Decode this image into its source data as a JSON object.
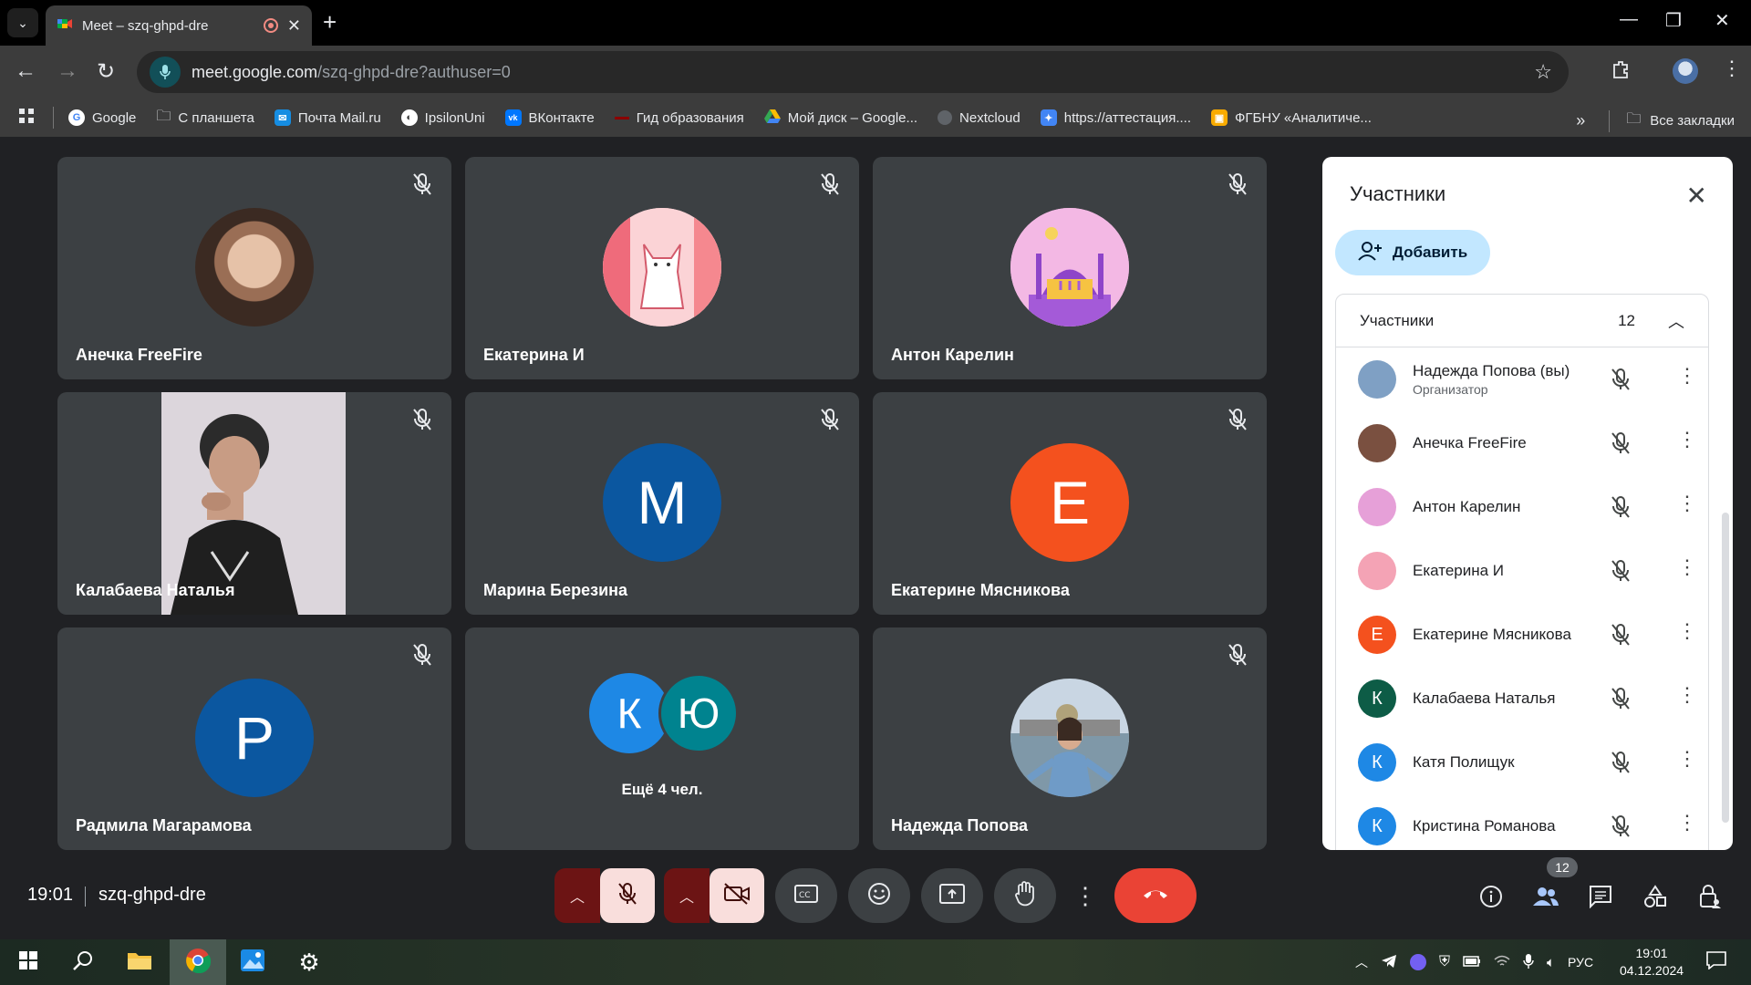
{
  "browser": {
    "tab_title": "Meet – szq-ghpd-dre",
    "url_host": "meet.google.com",
    "url_path": "/szq-ghpd-dre?authuser=0",
    "bookmarks": [
      {
        "label": "Google",
        "color": "#ffffff",
        "glyph": "G"
      },
      {
        "label": "С планшета",
        "color": "",
        "glyph": ""
      },
      {
        "label": "Почта Mail.ru",
        "color": "#168de2",
        "glyph": "@"
      },
      {
        "label": "IpsilonUni",
        "color": "#ffffff",
        "glyph": ""
      },
      {
        "label": "ВКонтакте",
        "color": "#0077ff",
        "glyph": "vk"
      },
      {
        "label": "Гид образования",
        "color": "#8b0000",
        "glyph": ""
      },
      {
        "label": "Мой диск – Google...",
        "color": "#34a853",
        "glyph": ""
      },
      {
        "label": "Nextcloud",
        "color": "#5f6368",
        "glyph": ""
      },
      {
        "label": "https://аттестация....",
        "color": "#4285f4",
        "glyph": ""
      },
      {
        "label": "ФГБНУ «Аналитиче...",
        "color": "#f9ab00",
        "glyph": ""
      }
    ],
    "all_bookmarks": "Все закладки"
  },
  "tiles": [
    {
      "name": "Анечка FreeFire",
      "kind": "photo",
      "bg": "#6b4a3a"
    },
    {
      "name": "Екатерина И",
      "kind": "photo",
      "bg": "#f4a3b5"
    },
    {
      "name": "Антон Карелин",
      "kind": "photo",
      "bg": "#e6a0d8"
    },
    {
      "name": "Калабаева Наталья",
      "kind": "video",
      "bg": ""
    },
    {
      "name": "Марина Березина",
      "kind": "letter",
      "letter": "М",
      "bg": "#0b57a0"
    },
    {
      "name": "Екатерине Мясникова",
      "kind": "letter",
      "letter": "Е",
      "bg": "#f4511e"
    },
    {
      "name": "Радмила Магарамова",
      "kind": "letter",
      "letter": "Р",
      "bg": "#0b57a0"
    },
    {
      "name": "",
      "kind": "more",
      "bg": ""
    },
    {
      "name": "Надежда Попова",
      "kind": "photo",
      "bg": "#9db3c9"
    }
  ],
  "more": {
    "label": "Ещё 4 чел.",
    "a1": {
      "letter": "К",
      "bg": "#1e88e5"
    },
    "a2": {
      "letter": "Ю",
      "bg": "#00838f"
    }
  },
  "panel": {
    "title": "Участники",
    "add_label": "Добавить",
    "group_label": "Участники",
    "group_count": "12",
    "people": [
      {
        "name": "Надежда Попова (вы)",
        "role": "Организатор",
        "letter": "",
        "bg": "#7fa0c4"
      },
      {
        "name": "Анечка FreeFire",
        "role": "",
        "letter": "",
        "bg": "#7a5040"
      },
      {
        "name": "Антон Карелин",
        "role": "",
        "letter": "",
        "bg": "#e6a0d8"
      },
      {
        "name": "Екатерина И",
        "role": "",
        "letter": "",
        "bg": "#f4a3b5"
      },
      {
        "name": "Екатерине Мясникова",
        "role": "",
        "letter": "Е",
        "bg": "#f4511e"
      },
      {
        "name": "Калабаева Наталья",
        "role": "",
        "letter": "К",
        "bg": "#0d5c46"
      },
      {
        "name": "Катя Полищук",
        "role": "",
        "letter": "К",
        "bg": "#1e88e5"
      },
      {
        "name": "Кристина Романова",
        "role": "",
        "letter": "К",
        "bg": "#1e88e5"
      }
    ]
  },
  "bottom": {
    "time": "19:01",
    "meeting_code": "szq-ghpd-dre",
    "people_badge": "12"
  },
  "taskbar": {
    "lang": "РУС",
    "time": "19:01",
    "date": "04.12.2024"
  }
}
